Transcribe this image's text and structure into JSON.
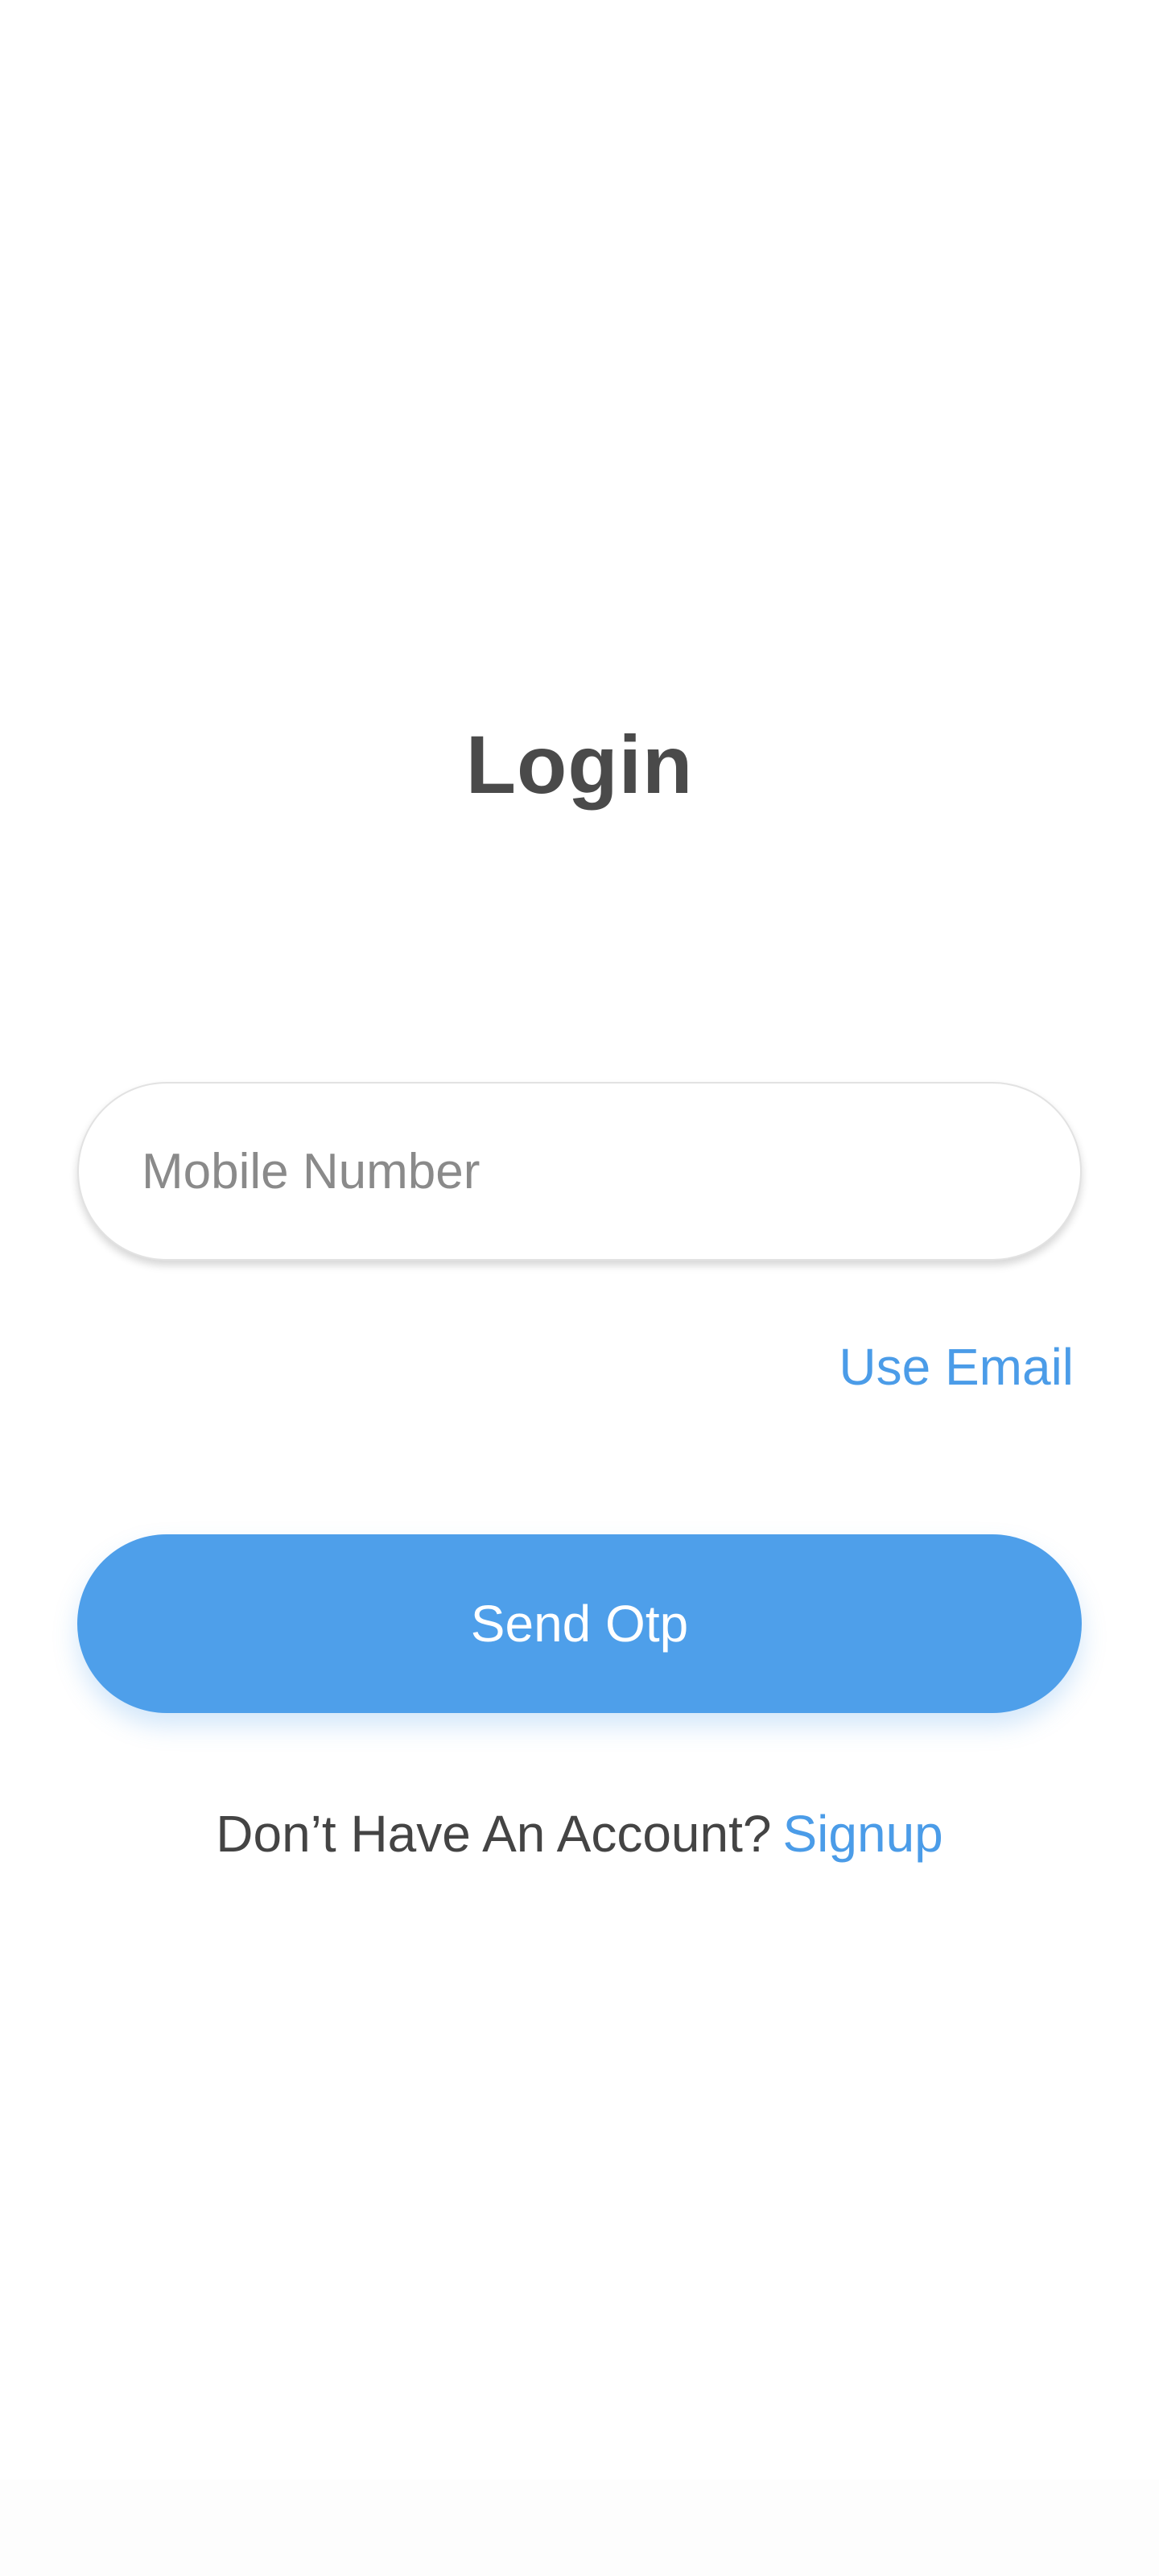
{
  "login": {
    "title": "Login",
    "mobile_placeholder": "Mobile Number",
    "mobile_value": "",
    "use_email_label": "Use Email",
    "send_otp_label": "Send Otp",
    "signup_prompt": "Don’t Have An Account?",
    "signup_label": "Signup"
  },
  "colors": {
    "accent": "#4e9fea",
    "link": "#4b9ce8",
    "title": "#4a4a4a",
    "placeholder": "#8a8a8a",
    "background": "#ffffff"
  }
}
